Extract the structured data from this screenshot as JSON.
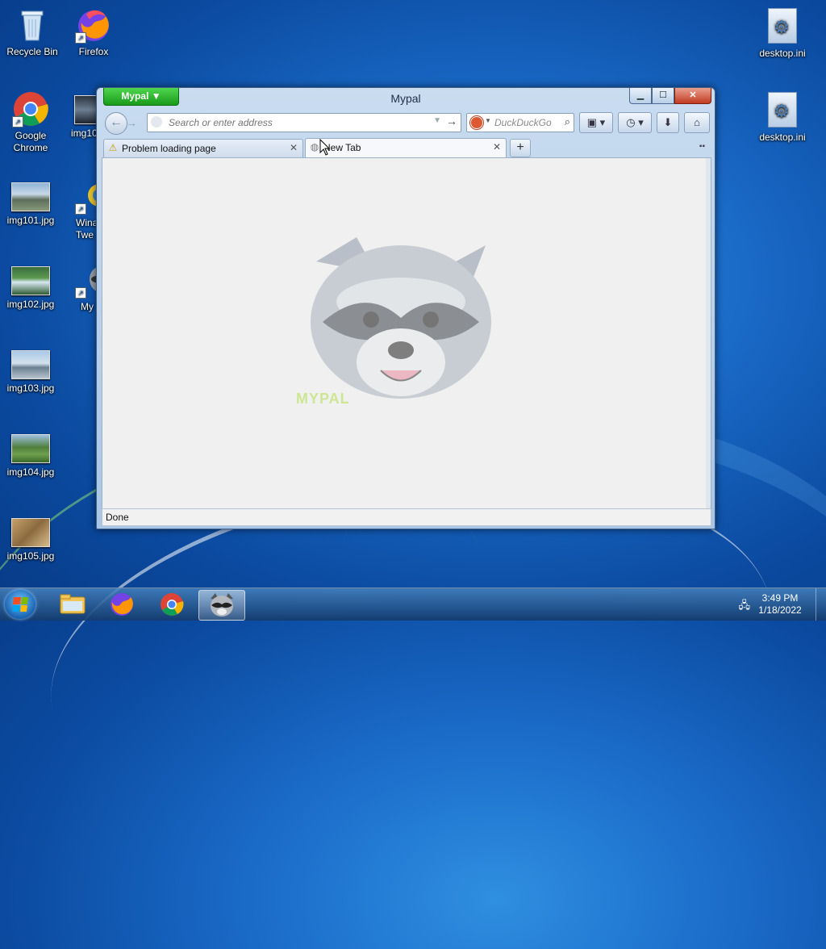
{
  "desktop": {
    "icons_left": [
      {
        "label": "Recycle Bin"
      },
      {
        "label": "Google Chrome"
      },
      {
        "label": "img101.jpg"
      },
      {
        "label": "img102.jpg"
      },
      {
        "label": "img103.jpg"
      },
      {
        "label": "img104.jpg"
      },
      {
        "label": "img105.jpg"
      }
    ],
    "icons_col2": [
      {
        "label": "Firefox"
      },
      {
        "label": "img10"
      },
      {
        "label": "Wina Twe"
      },
      {
        "label": "My"
      }
    ],
    "icons_right": [
      {
        "label": "desktop.ini"
      },
      {
        "label": "desktop.ini"
      }
    ]
  },
  "window": {
    "title": "Mypal",
    "app_menu": "Mypal ▼",
    "controls": {
      "minimize": "▁",
      "maximize": "☐",
      "close": "✕"
    },
    "nav": {
      "back": "←",
      "forward": "→",
      "url_placeholder": "Search or enter address",
      "go": "→",
      "search_engine": "DuckDuckGo",
      "search_glyph": "⌕"
    },
    "toolbar": {
      "history": "◷ ▾",
      "downloads": "⬇",
      "home": "⌂",
      "bookmarks": "▣ ▾"
    },
    "tabs": [
      {
        "label": "Problem loading page",
        "icon": "⚠",
        "close": "✕"
      },
      {
        "label": "New Tab",
        "icon": "◍",
        "close": "✕"
      }
    ],
    "new_tab": "+",
    "tab_list": "▪▪",
    "content_logo_text": "MYPAL",
    "status": "Done"
  },
  "taskbar": {
    "clock_time": "3:49 PM",
    "clock_date": "1/18/2022",
    "tray_icon": "network-icon"
  }
}
